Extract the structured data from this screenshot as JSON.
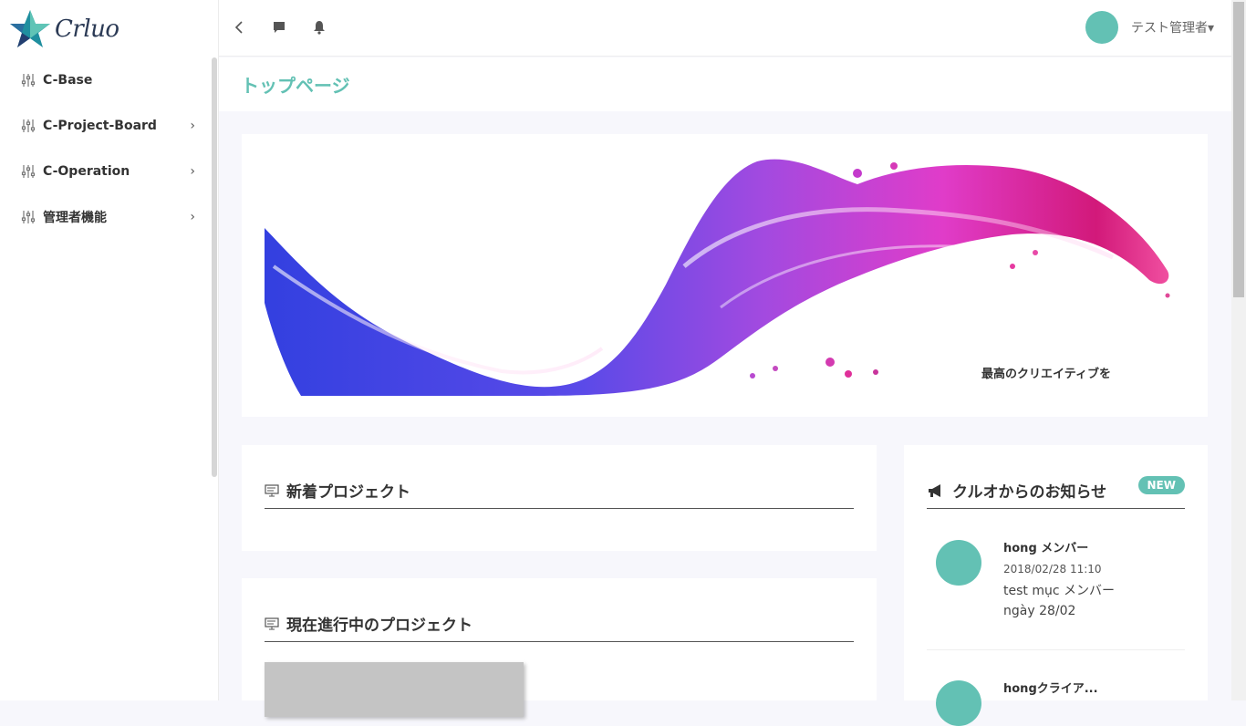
{
  "app": {
    "logo_text": "Crluo"
  },
  "sidebar": {
    "items": [
      {
        "label": "C-Base",
        "has_children": false
      },
      {
        "label": "C-Project-Board",
        "has_children": true
      },
      {
        "label": "C-Operation",
        "has_children": true
      },
      {
        "label": "管理者機能",
        "has_children": true
      }
    ]
  },
  "topbar": {
    "user_name": "テスト管理者▾",
    "icons": [
      "chevron-left-icon",
      "chat-icon",
      "bell-icon"
    ]
  },
  "page": {
    "title": "トップページ"
  },
  "banner": {
    "caption": "最高のクリエイティブを"
  },
  "cards": {
    "new_projects": {
      "title": "新着プロジェクト"
    },
    "current_projects": {
      "title": "現在進行中のプロジェクト"
    },
    "news": {
      "title": "クルオからのお知らせ",
      "badge": "NEW",
      "items": [
        {
          "author": "hong メンバー",
          "date": "2018/02/28 11:10",
          "body": "test mục メンバー ngày 28/02"
        },
        {
          "author": "hongクライア...",
          "date": "",
          "body": ""
        }
      ]
    }
  },
  "colors": {
    "accent": "#63c1b4",
    "sidebar_bg": "#ffffff",
    "page_bg": "#f7f7fc"
  }
}
